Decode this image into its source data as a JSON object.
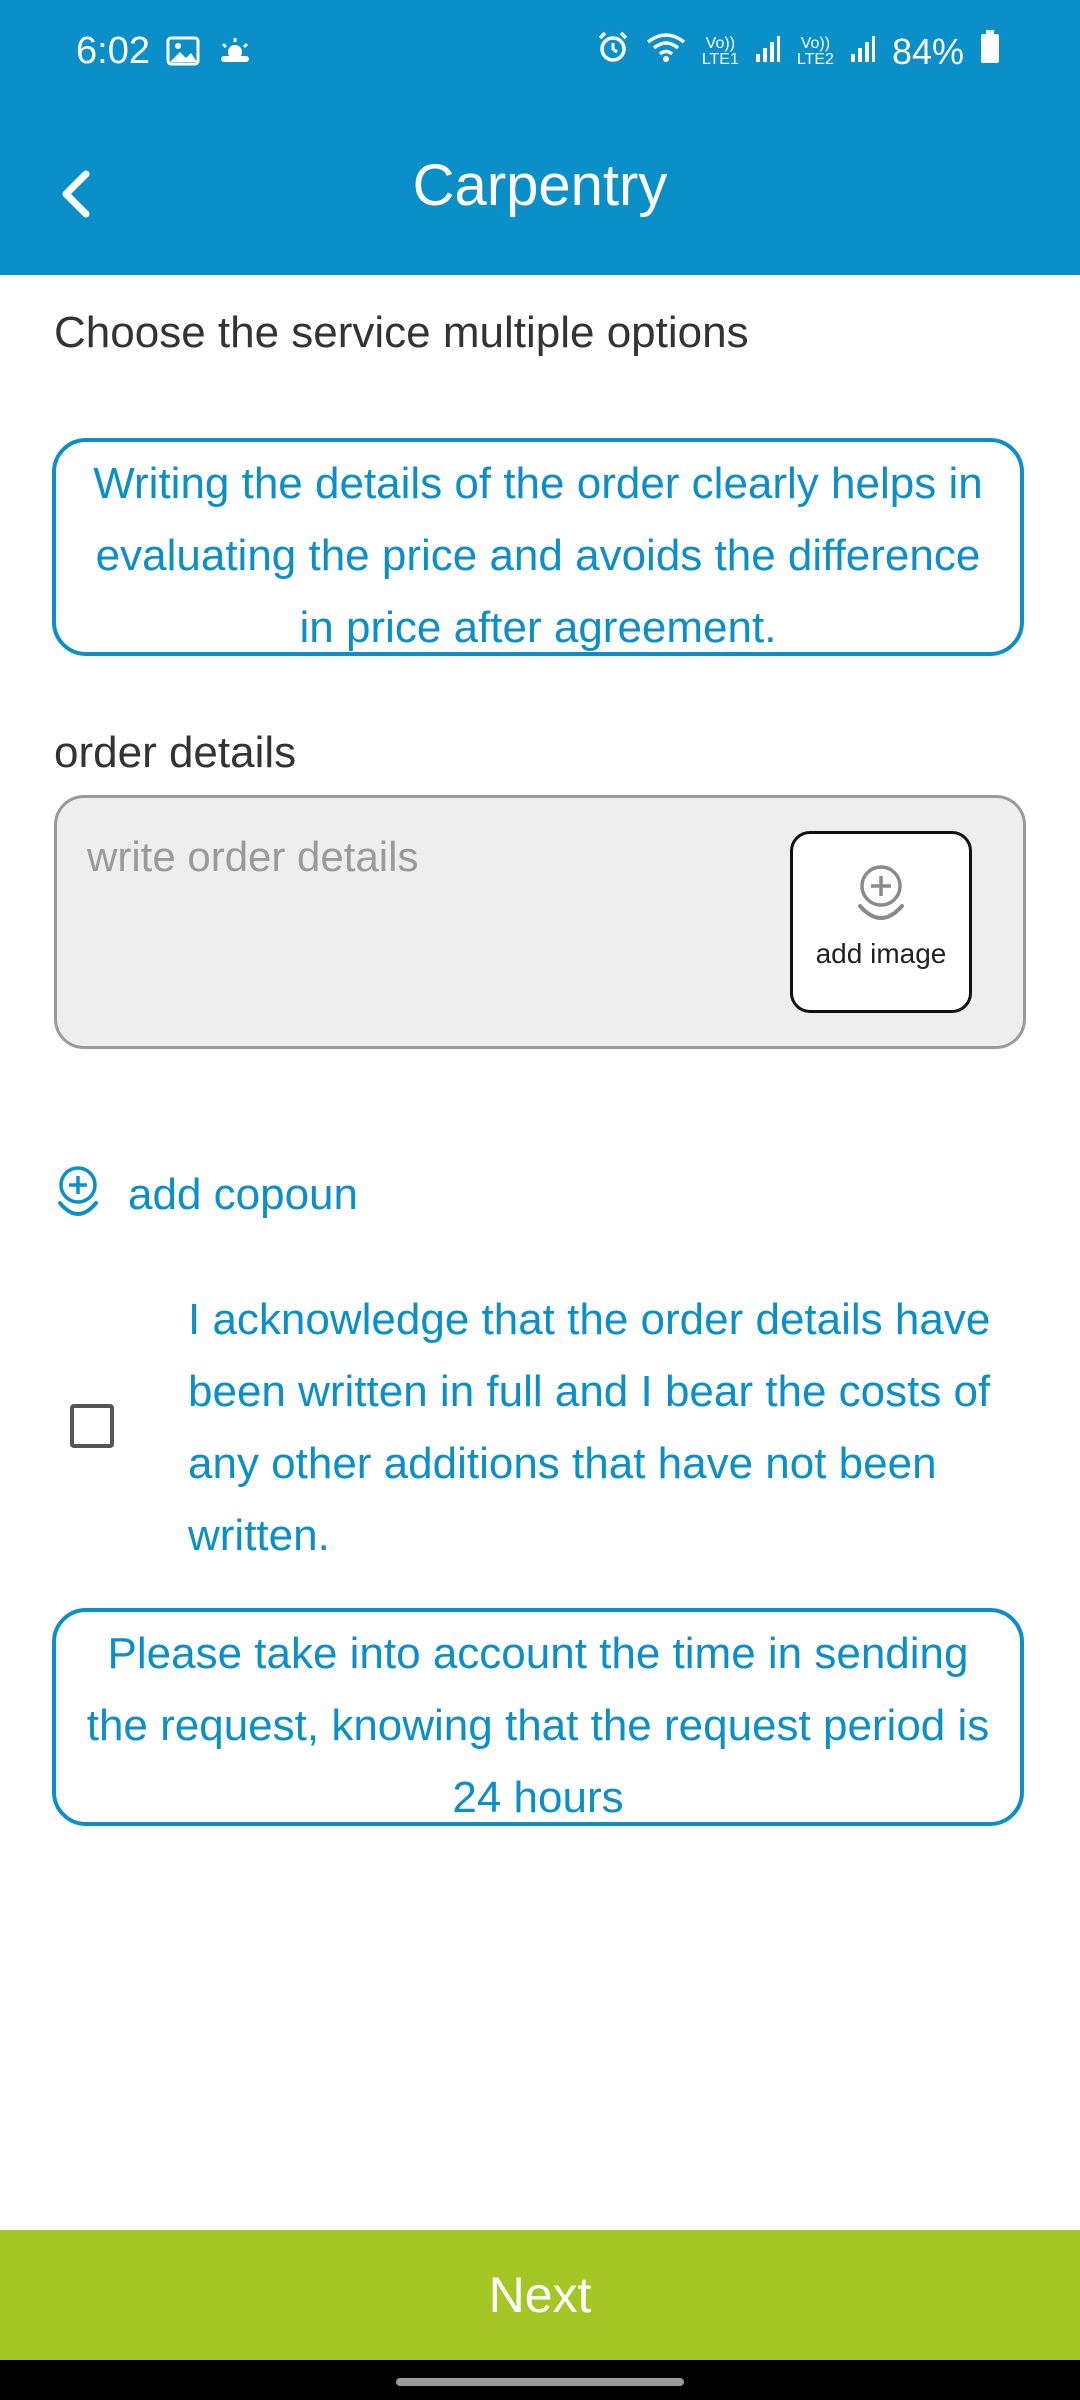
{
  "status_bar": {
    "time": "6:02",
    "sim1_top": "Vo))",
    "sim1_bottom": "LTE1",
    "sim2_top": "Vo))",
    "sim2_bottom": "LTE2",
    "battery": "84%",
    "icons": [
      "image-icon",
      "weather-icon",
      "alarm-icon",
      "wifi-icon",
      "signal-icon",
      "signal-icon",
      "battery-icon"
    ]
  },
  "app_bar": {
    "title": "Carpentry",
    "back_icon": "chevron-left-icon"
  },
  "main": {
    "section_title": "Choose the service multiple options",
    "notice_top": "Writing the details of the order clearly helps in evaluating the price and avoids the difference in price after agreement.",
    "order_label": "order details",
    "order_placeholder": "write order details",
    "order_value": "",
    "add_image_label": "add image",
    "add_coupon_label": "add copoun",
    "acknowledge_text": "I acknowledge that the order details have been written in full and I bear the costs of any other additions that have not been written.",
    "acknowledge_checked": false,
    "notice_bottom": "Please take into account the time in sending the request, knowing that the request period is 24 hours"
  },
  "footer": {
    "next_label": "Next"
  },
  "colors": {
    "primary": "#0B8FC9",
    "accent_green": "#A5C726",
    "input_bg": "#EEEEEE"
  }
}
